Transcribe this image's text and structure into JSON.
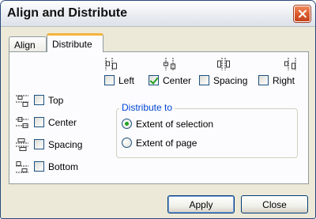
{
  "window": {
    "title": "Align and Distribute"
  },
  "tabs": [
    {
      "label": "Align",
      "active": false
    },
    {
      "label": "Distribute",
      "active": true
    }
  ],
  "horizontal_options": [
    {
      "label": "Left",
      "checked": false,
      "icon": "distribute-left-icon"
    },
    {
      "label": "Center",
      "checked": true,
      "icon": "distribute-center-icon"
    },
    {
      "label": "Spacing",
      "checked": false,
      "icon": "distribute-spacing-icon"
    },
    {
      "label": "Right",
      "checked": false,
      "icon": "distribute-right-icon"
    }
  ],
  "vertical_options": [
    {
      "label": "Top",
      "checked": false,
      "icon": "distribute-top-icon"
    },
    {
      "label": "Center",
      "checked": false,
      "icon": "distribute-vcenter-icon"
    },
    {
      "label": "Spacing",
      "checked": false,
      "icon": "distribute-vspacing-icon"
    },
    {
      "label": "Bottom",
      "checked": false,
      "icon": "distribute-bottom-icon"
    }
  ],
  "distribute_to": {
    "label": "Distribute to",
    "options": [
      {
        "label": "Extent of selection",
        "selected": true
      },
      {
        "label": "Extent of page",
        "selected": false
      }
    ]
  },
  "buttons": {
    "apply": "Apply",
    "close": "Close"
  },
  "colors": {
    "accent_tab": "#f5b33b",
    "check_green": "#21a121",
    "group_label": "#0046d5",
    "close_red": "#d9582a"
  }
}
